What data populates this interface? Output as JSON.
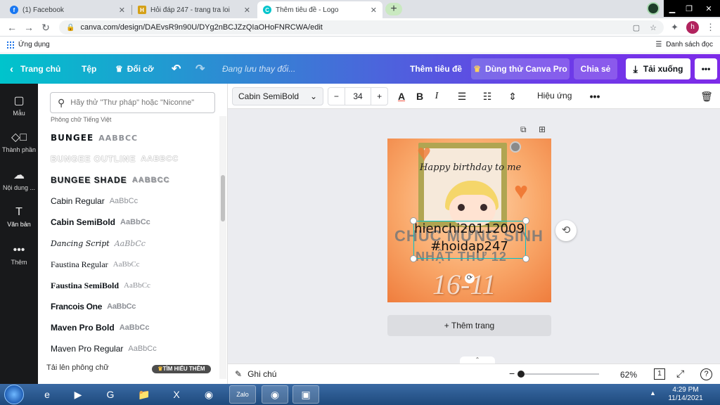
{
  "browser": {
    "tabs": [
      {
        "title": "(1) Facebook",
        "icon": "facebook-icon",
        "color": "#1877f2"
      },
      {
        "title": "Hỏi đáp 247 - trang tra loi",
        "icon": "hoidap-icon",
        "color": "#d4a017"
      },
      {
        "title": "Thêm tiêu đề - Logo",
        "icon": "canva-icon",
        "color": "#00c4cc"
      }
    ],
    "url": "canva.com/design/DAEvsR9n90U/DYg2nBCJZzQIaOHoFNRCWA/edit",
    "avatar_letter": "h",
    "bookmarks": {
      "apps_label": "Ứng dụng",
      "reading_list_label": "Danh sách đọc"
    }
  },
  "canva_header": {
    "home_label": "Trang chủ",
    "file_label": "Tệp",
    "resize_label": "Đổi cỡ",
    "saving_status": "Đang lưu thay đổi...",
    "title_placeholder": "Thêm tiêu đề",
    "try_pro_label": "Dùng thử Canva Pro",
    "share_label": "Chia sẻ",
    "download_label": "Tải xuống",
    "accent_gradient": [
      "#00c4cc",
      "#7d2ae8"
    ]
  },
  "left_rail": {
    "items": [
      {
        "label": "Mẫu",
        "icon": "templates-icon"
      },
      {
        "label": "Thành phần",
        "icon": "elements-icon"
      },
      {
        "label": "Nội dung ...",
        "icon": "uploads-icon"
      },
      {
        "label": "Văn bản",
        "icon": "text-icon"
      },
      {
        "label": "Thêm",
        "icon": "more-icon"
      }
    ]
  },
  "font_panel": {
    "search_placeholder": "Hãy thử \"Thư pháp\" hoặc \"Niconne\"",
    "section_label": "Phông chữ Tiếng Việt",
    "fonts": [
      {
        "name": "BUNGEE",
        "sample": "AABBCC"
      },
      {
        "name": "BUNGEE OUTLINE",
        "sample": "AABBCC"
      },
      {
        "name": "BUNGEE SHADE",
        "sample": "AABBCC"
      },
      {
        "name": "Cabin Regular",
        "sample": "AaBbCc"
      },
      {
        "name": "Cabin SemiBold",
        "sample": "AaBbCc"
      },
      {
        "name": "Dancing Script",
        "sample": "AaBbCc"
      },
      {
        "name": "Faustina Regular",
        "sample": "AaBbCc"
      },
      {
        "name": "Faustina SemiBold",
        "sample": "AaBbCc"
      },
      {
        "name": "Francois One",
        "sample": "AaBbCc"
      },
      {
        "name": "Maven Pro Bold",
        "sample": "AaBbCc"
      },
      {
        "name": "Maven Pro Regular",
        "sample": "AaBbCc"
      }
    ],
    "upload_label": "Tải lên phông chữ",
    "learn_more_label": "TÌM HIỂU THÊM"
  },
  "text_toolbar": {
    "font_family": "Cabin SemiBold",
    "font_size": "34",
    "bold": "B",
    "italic": "I",
    "effects_label": "Hiệu ứng"
  },
  "design": {
    "birthday_text": "Happy birthday to me",
    "ghost_line_1": "CHÚC MỪNG SINH",
    "ghost_line_2": "NHẬT THỨ 12",
    "date_text": "16-11",
    "selected_line_1": "hienchi20112009",
    "selected_line_2": "#hoidap247",
    "add_page_label": "+ Thêm trang"
  },
  "bottom_bar": {
    "notes_label": "Ghi chú",
    "zoom_percent": "62%",
    "zoom_fraction": 0.0,
    "page_count": "1",
    "help_label": "?"
  },
  "taskbar": {
    "time": "4:29 PM",
    "date": "11/14/2021",
    "apps": [
      {
        "icon": "ie-icon",
        "label": "e"
      },
      {
        "icon": "media-player-icon",
        "label": "▶"
      },
      {
        "icon": "app-green-icon",
        "label": "G"
      },
      {
        "icon": "file-explorer-icon",
        "label": "📁"
      },
      {
        "icon": "excel-icon",
        "label": "X"
      },
      {
        "icon": "chrome-icon",
        "label": "◉"
      },
      {
        "icon": "zalo-icon",
        "label": "Zalo"
      },
      {
        "icon": "chrome-profile-icon",
        "label": "◉"
      },
      {
        "icon": "zoom-icon",
        "label": "▣"
      }
    ]
  }
}
